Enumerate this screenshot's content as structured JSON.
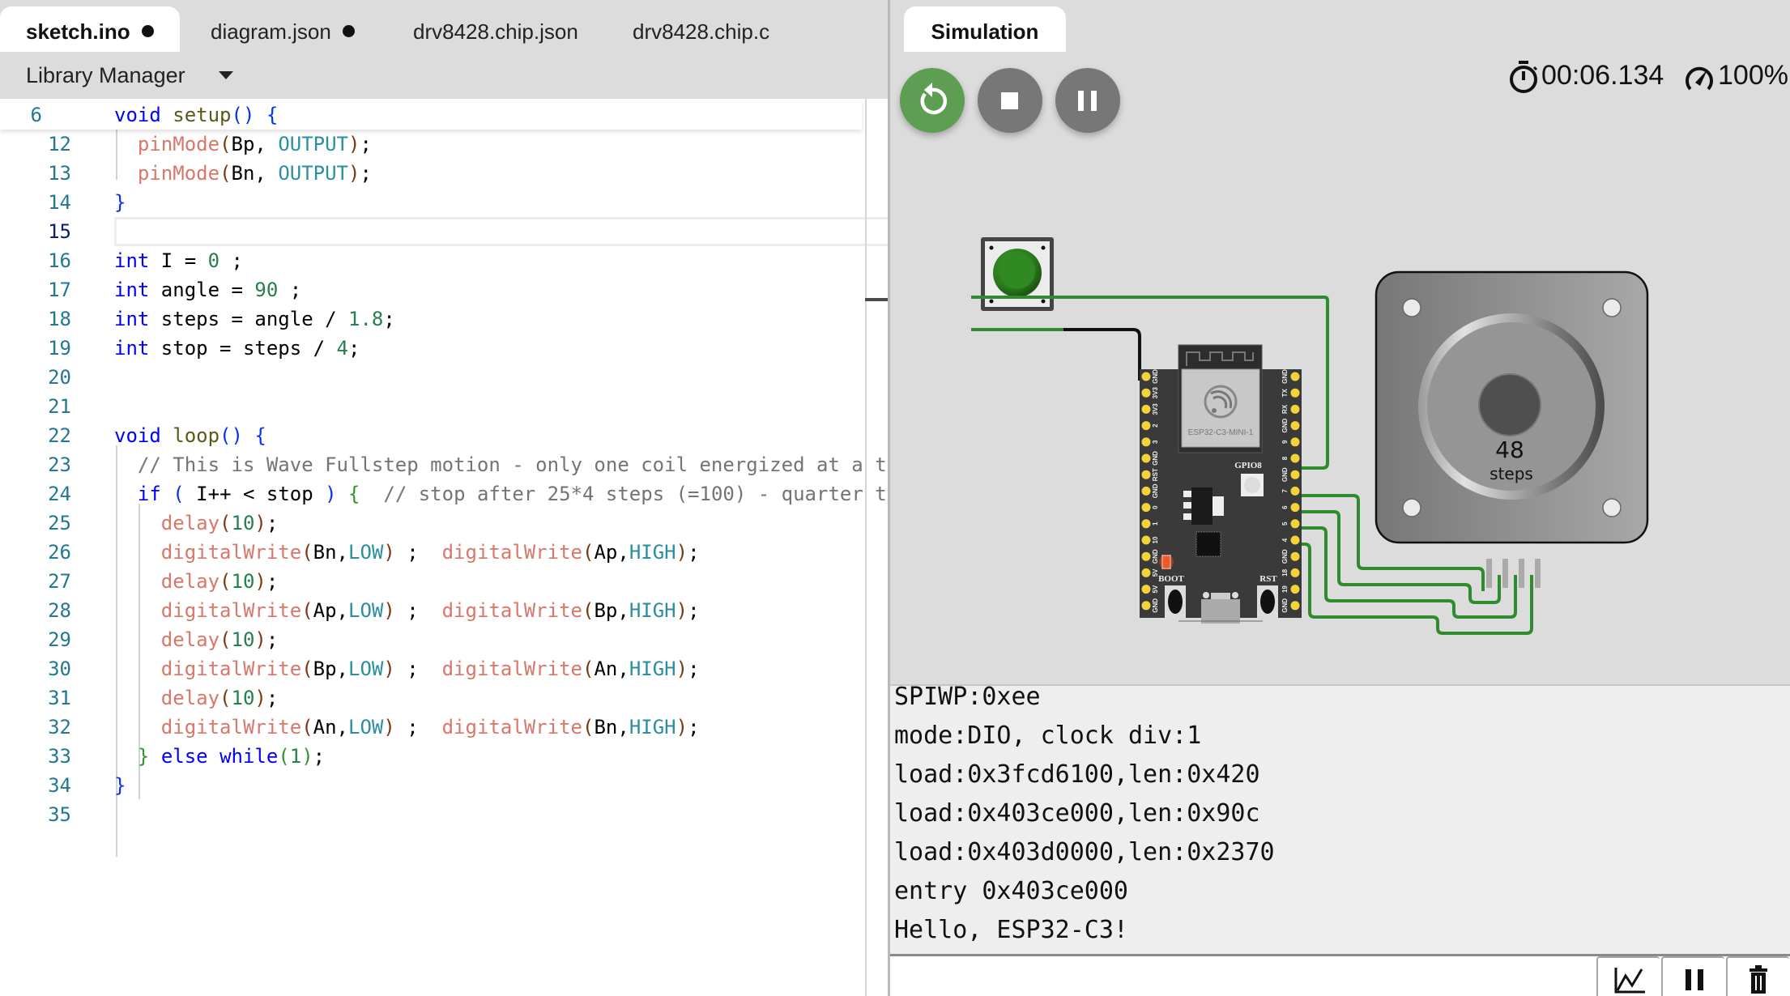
{
  "editor": {
    "tabs": [
      {
        "label": "sketch.ino",
        "modified": true,
        "active": true
      },
      {
        "label": "diagram.json",
        "modified": true,
        "active": false
      },
      {
        "label": "drv8428.chip.json",
        "modified": false,
        "active": false
      },
      {
        "label": "drv8428.chip.c",
        "modified": false,
        "active": false
      }
    ],
    "library_manager_label": "Library Manager",
    "sticky_line": {
      "number": "6",
      "text": "void setup() {"
    },
    "current_line": "15",
    "lines": [
      {
        "n": "12",
        "text": "  pinMode(Bp, OUTPUT);"
      },
      {
        "n": "13",
        "text": "  pinMode(Bn, OUTPUT);"
      },
      {
        "n": "14",
        "text": "}"
      },
      {
        "n": "15",
        "text": ""
      },
      {
        "n": "16",
        "text": "int I = 0 ;"
      },
      {
        "n": "17",
        "text": "int angle = 90 ;"
      },
      {
        "n": "18",
        "text": "int steps = angle / 1.8;"
      },
      {
        "n": "19",
        "text": "int stop = steps / 4;"
      },
      {
        "n": "20",
        "text": ""
      },
      {
        "n": "21",
        "text": ""
      },
      {
        "n": "22",
        "text": "void loop() {"
      },
      {
        "n": "23",
        "text": "  // This is Wave Fullstep motion - only one coil energized at a t"
      },
      {
        "n": "24",
        "text": "  if ( I++ < stop ) {  // stop after 25*4 steps (=100) - quarter t"
      },
      {
        "n": "25",
        "text": "    delay(10);"
      },
      {
        "n": "26",
        "text": "    digitalWrite(Bn,LOW) ;  digitalWrite(Ap,HIGH);"
      },
      {
        "n": "27",
        "text": "    delay(10);"
      },
      {
        "n": "28",
        "text": "    digitalWrite(Ap,LOW) ;  digitalWrite(Bp,HIGH);"
      },
      {
        "n": "29",
        "text": "    delay(10);"
      },
      {
        "n": "30",
        "text": "    digitalWrite(Bp,LOW) ;  digitalWrite(An,HIGH);"
      },
      {
        "n": "31",
        "text": "    delay(10);"
      },
      {
        "n": "32",
        "text": "    digitalWrite(An,LOW) ;  digitalWrite(Bn,HIGH);"
      },
      {
        "n": "33",
        "text": "  } else while(1);"
      },
      {
        "n": "34",
        "text": "}"
      },
      {
        "n": "35",
        "text": ""
      }
    ]
  },
  "simulation": {
    "tab_label": "Simulation",
    "buttons": {
      "restart": "restart-icon",
      "stop": "stop-icon",
      "pause": "pause-icon"
    },
    "elapsed_time": "00:06.134",
    "speed": "100%",
    "colors": {
      "restart_green": "#5d9e52",
      "control_gray": "#777777",
      "wire_green": "#2e8b2e",
      "button_green": "#2e7d1e",
      "board": "#3a3a3a",
      "pin_yellow": "#f2d33a"
    },
    "diagram": {
      "pushbutton": {
        "color": "green"
      },
      "board": {
        "module_label": "ESP32-C3-MINI-1",
        "led_label": "GPIO8",
        "boot_label": "BOOT",
        "rst_label": "RST",
        "left_pins": [
          "GND",
          "3V3",
          "3V3",
          "2",
          "3",
          "GND",
          "RST",
          "GND",
          "0",
          "1",
          "10",
          "GND",
          "5V",
          "5V",
          "GND"
        ],
        "right_pins": [
          "GND",
          "TX",
          "RX",
          "GND",
          "9",
          "8",
          "GND",
          "7",
          "6",
          "5",
          "4",
          "GND",
          "18",
          "19",
          "GND"
        ]
      },
      "stepper": {
        "steps_value": "48",
        "steps_label": "steps"
      }
    }
  },
  "serial_monitor": {
    "lines": [
      "SPIWP:0xee",
      "mode:DIO, clock div:1",
      "load:0x3fcd6100,len:0x420",
      "load:0x403ce000,len:0x90c",
      "load:0x403d0000,len:0x2370",
      "entry 0x403ce000",
      "Hello, ESP32-C3!"
    ],
    "input_value": "",
    "tools": [
      "plotter-icon",
      "pause-icon",
      "clear-trash-icon"
    ]
  }
}
